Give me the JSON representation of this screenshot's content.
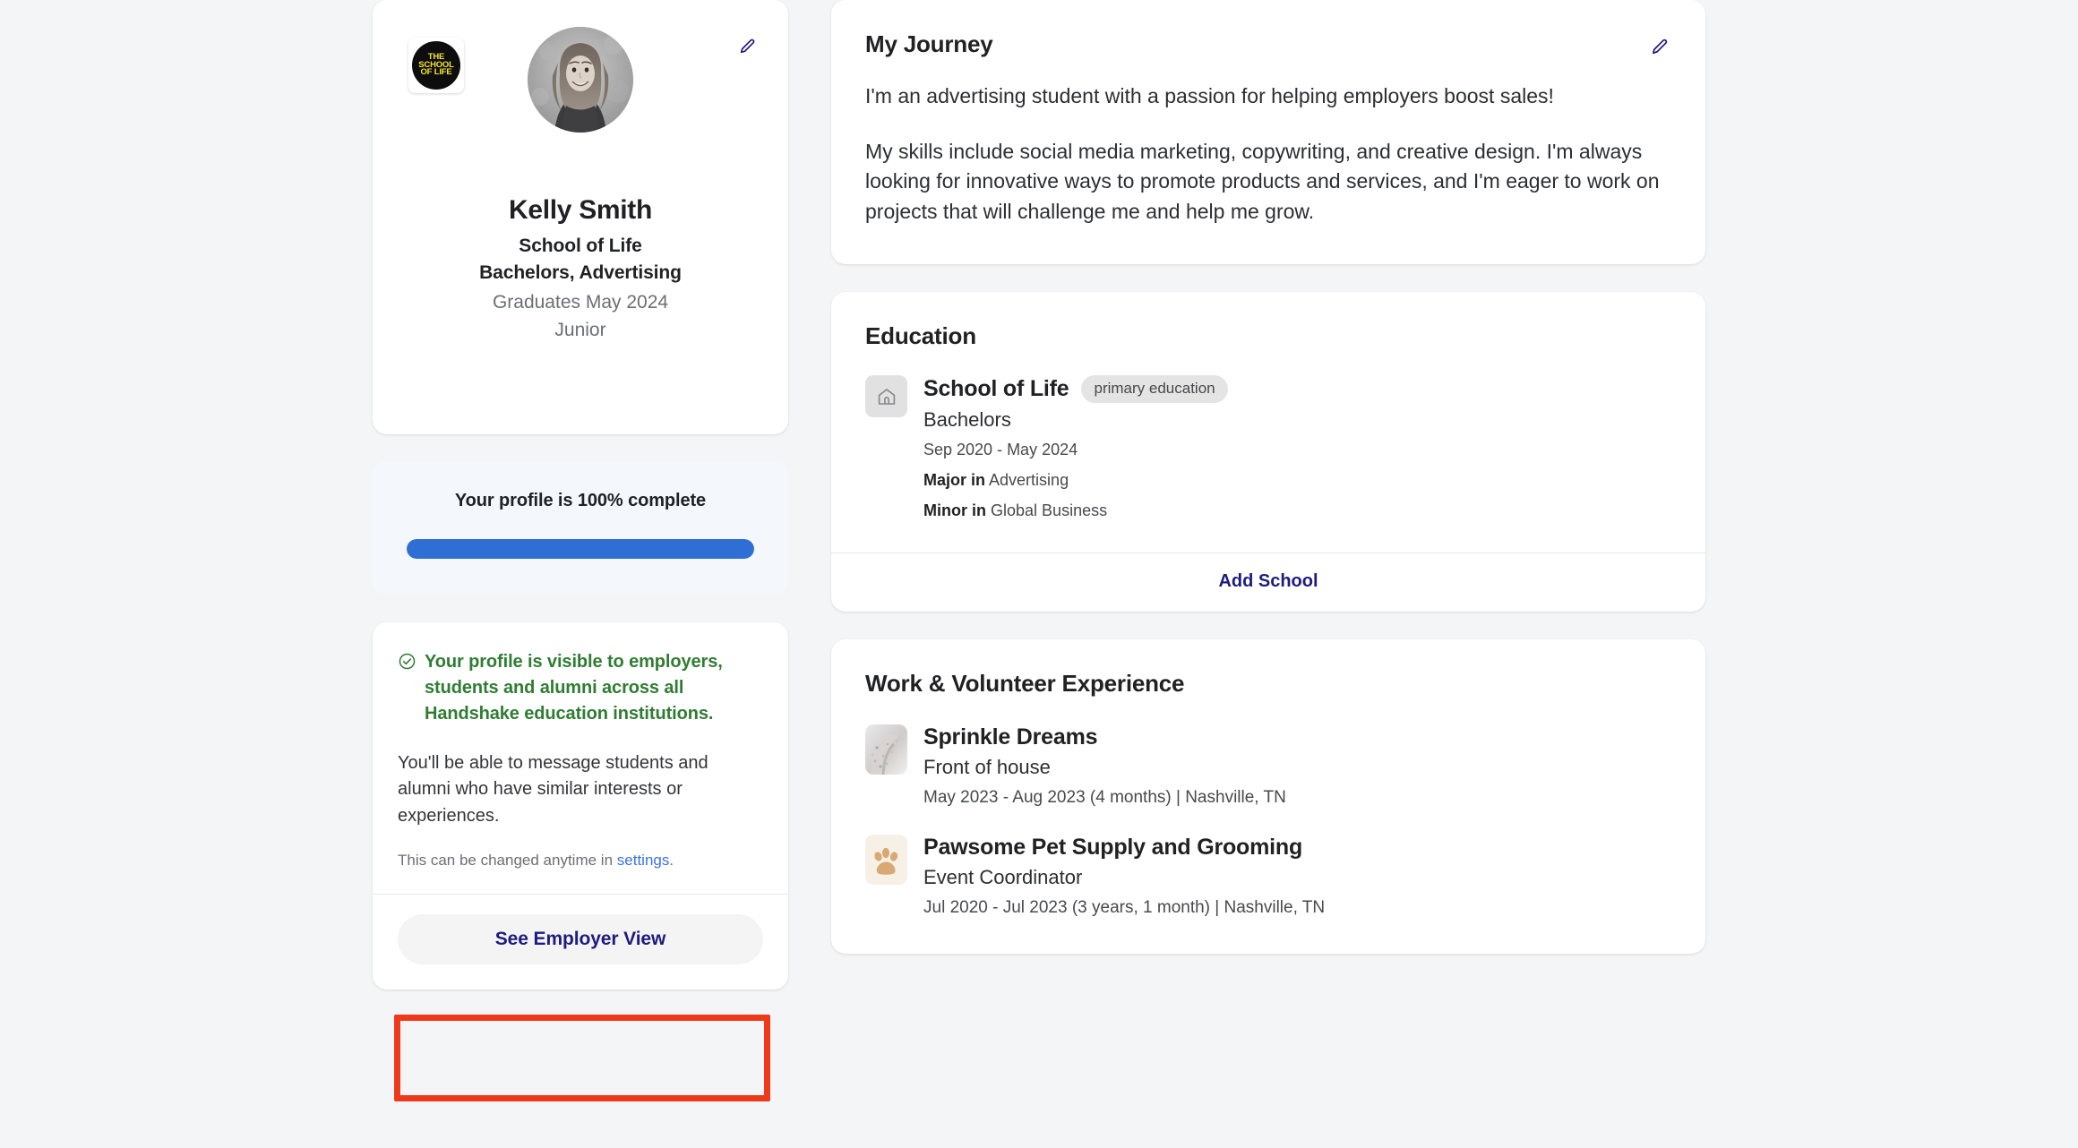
{
  "profile": {
    "school_logo_lines": [
      "THE",
      "SCHOOL",
      "OF LIFE"
    ],
    "avatar_alt": "Kelly Smith profile photo",
    "name": "Kelly Smith",
    "school": "School of Life",
    "degree": "Bachelors, Advertising",
    "graduation": "Graduates May 2024",
    "class_year": "Junior",
    "edit_icon": "pencil-icon"
  },
  "progress": {
    "label": "Your profile is 100% complete",
    "percent": 100,
    "fill_color": "#2f6fd4",
    "track_color": "#dbe4f0",
    "card_background": "#f4f8fd"
  },
  "visibility": {
    "check_icon": "check-circle-icon",
    "headline": "Your profile is visible to employers, students and alumni across all Handshake education institutions.",
    "headline_color": "#2f7d32",
    "body": "You'll be able to message students and alumni who have similar interests or experiences.",
    "note_prefix": "This can be changed anytime in ",
    "note_link": "settings",
    "note_suffix": ".",
    "link_color": "#3b73df",
    "employer_button": "See Employer View",
    "employer_button_color": "#1f1b7d"
  },
  "journey": {
    "title": "My Journey",
    "edit_icon": "pencil-icon",
    "paragraphs": [
      "I'm an advertising student with a passion for helping employers boost sales!",
      "My skills include social media marketing, copywriting, and creative design. I'm always looking for innovative ways to promote products and services, and I'm eager to work on projects that will challenge me and help me grow."
    ]
  },
  "education": {
    "title": "Education",
    "items": [
      {
        "icon": "school-building-icon",
        "school": "School of Life",
        "badge": "primary education",
        "degree": "Bachelors",
        "dates": "Sep 2020 - May 2024",
        "major_label": "Major in",
        "major_value": "Advertising",
        "minor_label": "Minor in",
        "minor_value": "Global Business"
      }
    ],
    "add_link": "Add School"
  },
  "work": {
    "title": "Work & Volunteer Experience",
    "items": [
      {
        "logo": "sprinkle-dreams-photo-logo",
        "name": "Sprinkle Dreams",
        "role": "Front of house",
        "dates": "May 2023 - Aug 2023 (4 months) | Nashville, TN"
      },
      {
        "logo": "paw-print-icon",
        "name": "Pawsome Pet Supply and Grooming",
        "role": "Event Coordinator",
        "dates": "Jul 2020 - Jul 2023 (3 years, 1 month) | Nashville, TN"
      }
    ]
  },
  "annotation": {
    "color": "#ee3a1a",
    "target": "See Employer View"
  }
}
